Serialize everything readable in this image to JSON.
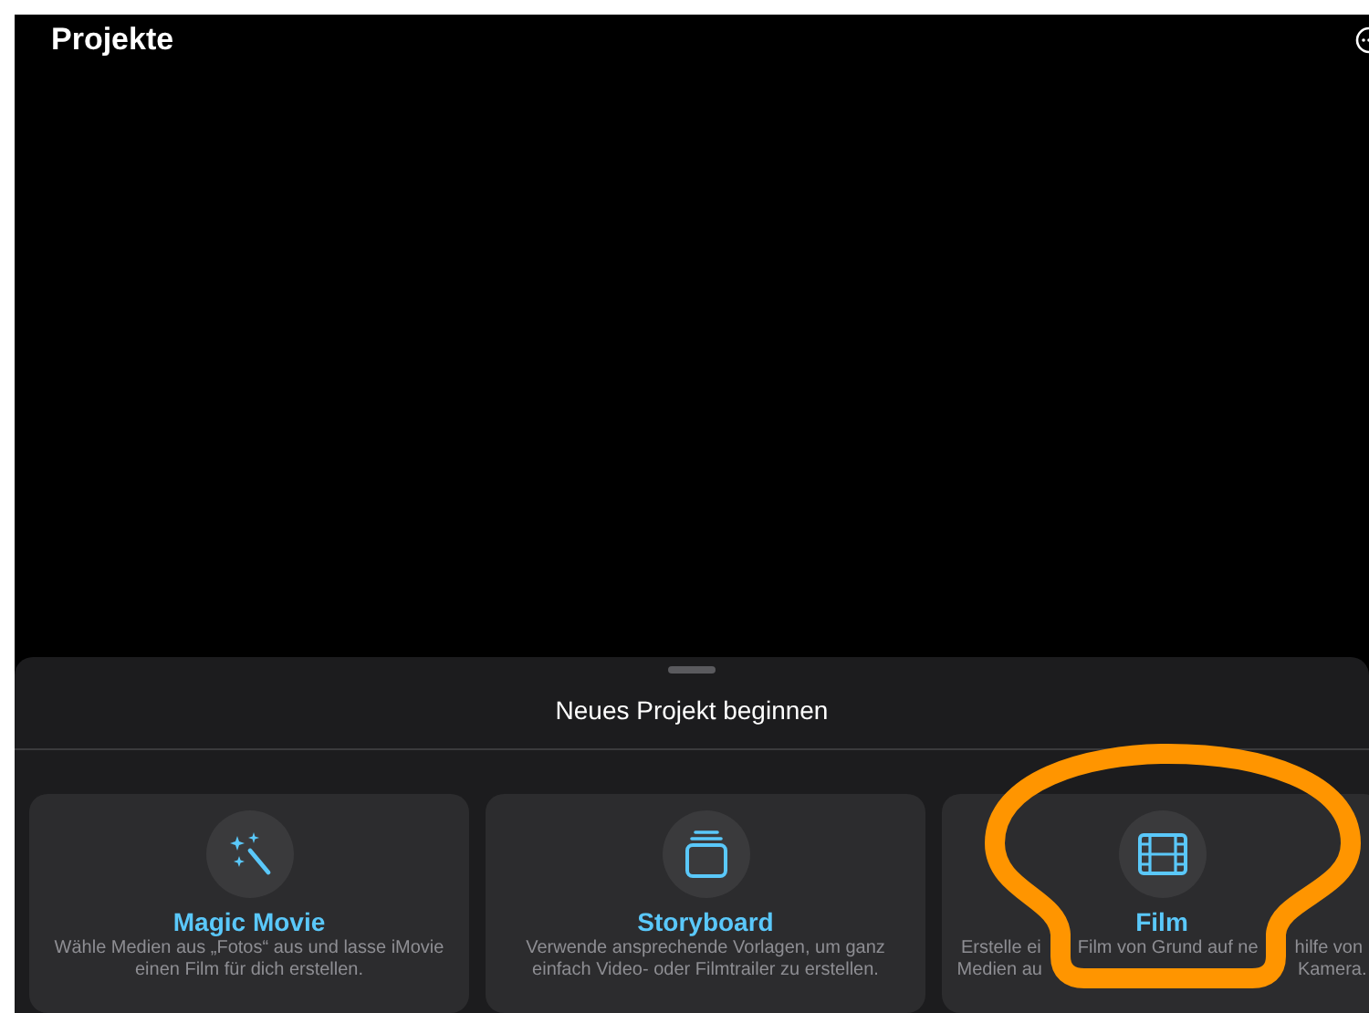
{
  "title": "Projekte",
  "sheet": {
    "title": "Neues Projekt beginnen",
    "options": [
      {
        "kind": "magic",
        "title": "Magic Movie",
        "highlighted": false,
        "lines": [
          [
            "Wähle Medien aus „Fotos“ aus und lasse iMovie"
          ],
          [
            "einen Film für dich erstellen."
          ]
        ]
      },
      {
        "kind": "storyboard",
        "title": "Storyboard",
        "highlighted": false,
        "lines": [
          [
            "Verwende ansprechende Vorlagen, um ganz"
          ],
          [
            "einfach Video- oder Filmtrailer zu erstellen."
          ]
        ]
      },
      {
        "kind": "film",
        "title": "Film",
        "highlighted": true,
        "lines": [
          [
            "Erstelle ei",
            "Film von Grund auf ne",
            "hilfe von"
          ],
          [
            "Medien au",
            "Kamera."
          ]
        ]
      }
    ]
  }
}
